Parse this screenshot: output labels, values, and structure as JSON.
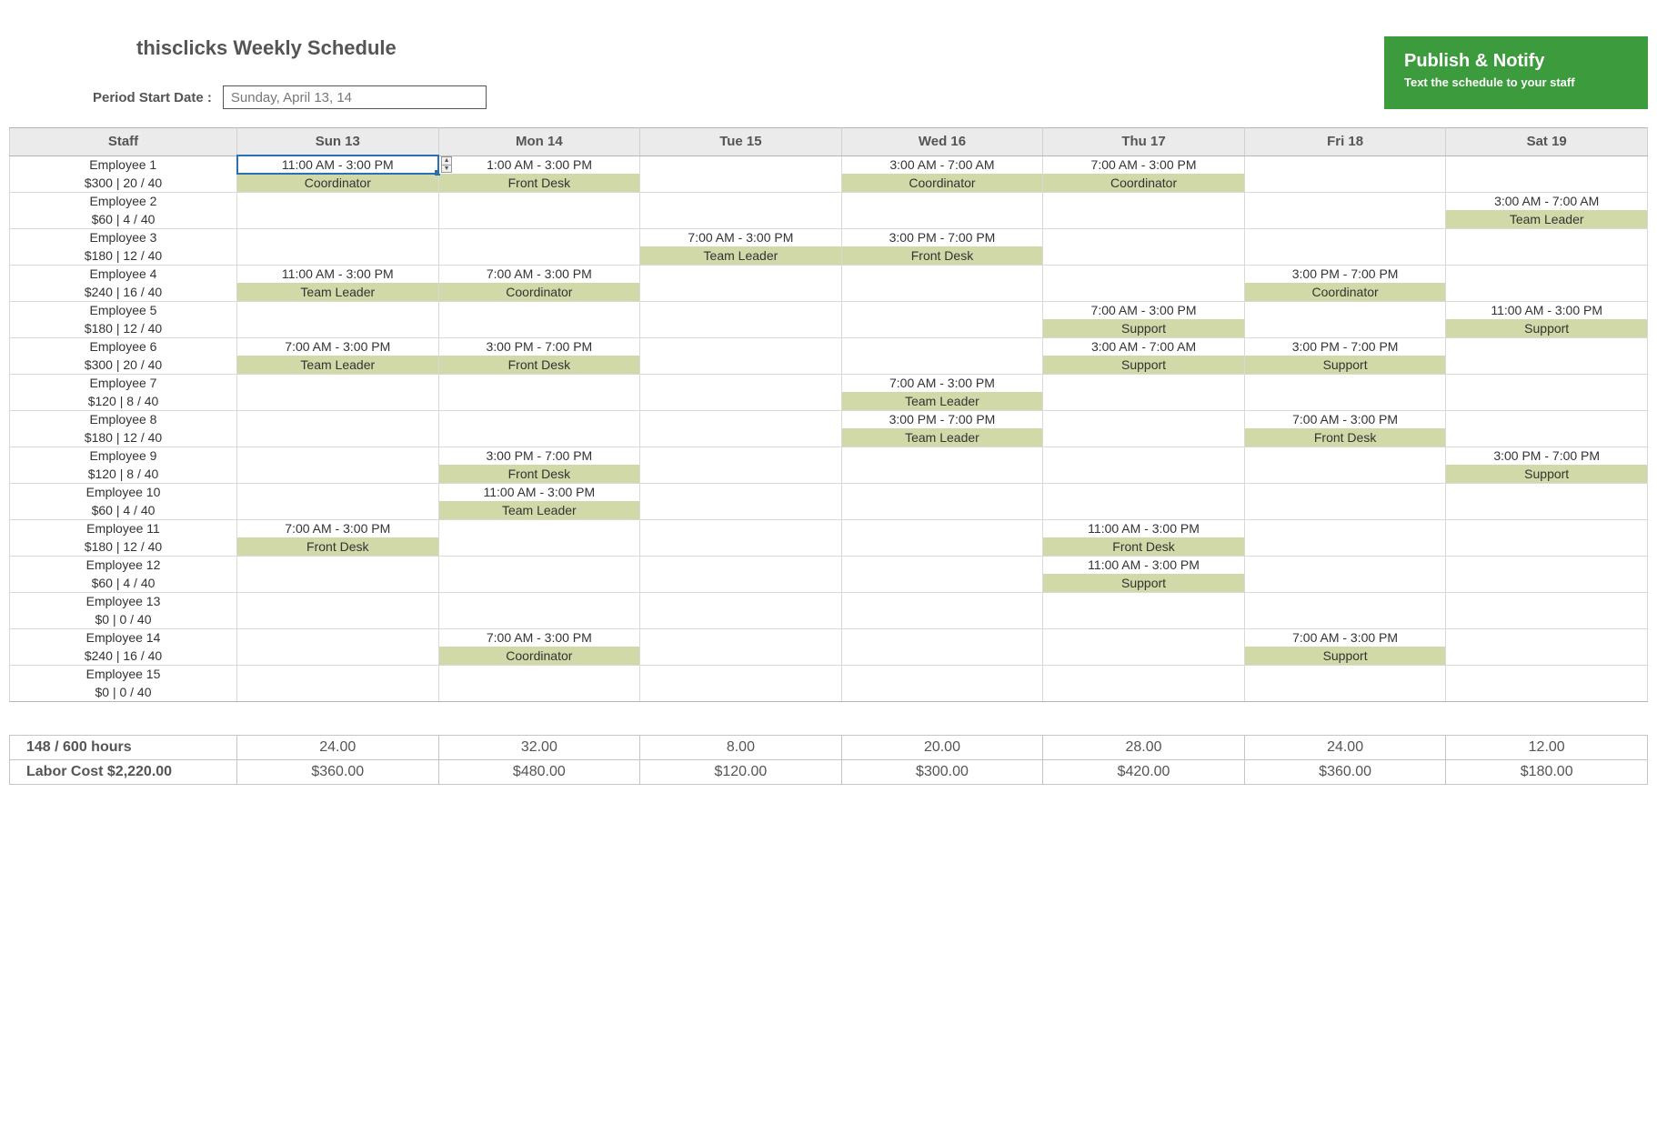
{
  "title": "thisclicks Weekly Schedule",
  "period_label": "Period Start Date :",
  "period_value": "Sunday, April 13, 14",
  "publish": {
    "title": "Publish & Notify",
    "subtitle": "Text the schedule to your staff"
  },
  "columns": [
    "Staff",
    "Sun 13",
    "Mon 14",
    "Tue 15",
    "Wed 16",
    "Thu 17",
    "Fri 18",
    "Sat 19"
  ],
  "selected_cell": {
    "row": 0,
    "day": 0
  },
  "employees": [
    {
      "name": "Employee 1",
      "info": "$300 | 20 / 40",
      "shifts": [
        {
          "time": "11:00 AM - 3:00 PM",
          "role": "Coordinator"
        },
        {
          "time": "1:00 AM - 3:00 PM",
          "role": "Front Desk",
          "stepper": true
        },
        null,
        {
          "time": "3:00 AM - 7:00 AM",
          "role": "Coordinator"
        },
        {
          "time": "7:00 AM - 3:00 PM",
          "role": "Coordinator"
        },
        null,
        null
      ]
    },
    {
      "name": "Employee 2",
      "info": "$60 | 4 / 40",
      "shifts": [
        null,
        null,
        null,
        null,
        null,
        null,
        {
          "time": "3:00 AM - 7:00 AM",
          "role": "Team Leader"
        }
      ]
    },
    {
      "name": "Employee 3",
      "info": "$180 | 12 / 40",
      "shifts": [
        null,
        null,
        {
          "time": "7:00 AM - 3:00 PM",
          "role": "Team Leader"
        },
        {
          "time": "3:00 PM - 7:00 PM",
          "role": "Front Desk"
        },
        null,
        null,
        null
      ]
    },
    {
      "name": "Employee 4",
      "info": "$240 | 16 / 40",
      "shifts": [
        {
          "time": "11:00 AM - 3:00 PM",
          "role": "Team Leader"
        },
        {
          "time": "7:00 AM - 3:00 PM",
          "role": "Coordinator"
        },
        null,
        null,
        null,
        {
          "time": "3:00 PM - 7:00 PM",
          "role": "Coordinator"
        },
        null
      ]
    },
    {
      "name": "Employee 5",
      "info": "$180 | 12 / 40",
      "shifts": [
        null,
        null,
        null,
        null,
        {
          "time": "7:00 AM - 3:00 PM",
          "role": "Support"
        },
        null,
        {
          "time": "11:00 AM - 3:00 PM",
          "role": "Support"
        }
      ]
    },
    {
      "name": "Employee 6",
      "info": "$300 | 20 / 40",
      "shifts": [
        {
          "time": "7:00 AM - 3:00 PM",
          "role": "Team Leader"
        },
        {
          "time": "3:00 PM - 7:00 PM",
          "role": "Front Desk"
        },
        null,
        null,
        {
          "time": "3:00 AM - 7:00 AM",
          "role": "Support"
        },
        {
          "time": "3:00 PM - 7:00 PM",
          "role": "Support"
        },
        null
      ]
    },
    {
      "name": "Employee 7",
      "info": "$120 | 8 / 40",
      "shifts": [
        null,
        null,
        null,
        {
          "time": "7:00 AM - 3:00 PM",
          "role": "Team Leader"
        },
        null,
        null,
        null
      ]
    },
    {
      "name": "Employee 8",
      "info": "$180 | 12 / 40",
      "shifts": [
        null,
        null,
        null,
        {
          "time": "3:00 PM - 7:00 PM",
          "role": "Team Leader"
        },
        null,
        {
          "time": "7:00 AM - 3:00 PM",
          "role": "Front Desk"
        },
        null
      ]
    },
    {
      "name": "Employee 9",
      "info": "$120 | 8 / 40",
      "shifts": [
        null,
        {
          "time": "3:00 PM - 7:00 PM",
          "role": "Front Desk"
        },
        null,
        null,
        null,
        null,
        {
          "time": "3:00 PM - 7:00 PM",
          "role": "Support"
        }
      ]
    },
    {
      "name": "Employee 10",
      "info": "$60 | 4 / 40",
      "shifts": [
        null,
        {
          "time": "11:00 AM - 3:00 PM",
          "role": "Team Leader"
        },
        null,
        null,
        null,
        null,
        null
      ]
    },
    {
      "name": "Employee 11",
      "info": "$180 | 12 / 40",
      "shifts": [
        {
          "time": "7:00 AM - 3:00 PM",
          "role": "Front Desk"
        },
        null,
        null,
        null,
        {
          "time": "11:00 AM - 3:00 PM",
          "role": "Front Desk"
        },
        null,
        null
      ]
    },
    {
      "name": "Employee 12",
      "info": "$60 | 4 / 40",
      "shifts": [
        null,
        null,
        null,
        null,
        {
          "time": "11:00 AM - 3:00 PM",
          "role": "Support"
        },
        null,
        null
      ]
    },
    {
      "name": "Employee 13",
      "info": "$0 | 0 / 40",
      "shifts": [
        null,
        null,
        null,
        null,
        null,
        null,
        null
      ]
    },
    {
      "name": "Employee 14",
      "info": "$240 | 16 / 40",
      "shifts": [
        null,
        {
          "time": "7:00 AM - 3:00 PM",
          "role": "Coordinator"
        },
        null,
        null,
        null,
        {
          "time": "7:00 AM - 3:00 PM",
          "role": "Support"
        },
        null
      ]
    },
    {
      "name": "Employee 15",
      "info": "$0 | 0 / 40",
      "shifts": [
        null,
        null,
        null,
        null,
        null,
        null,
        null
      ]
    }
  ],
  "summary": {
    "hours_label": "148 / 600 hours",
    "hours": [
      "24.00",
      "32.00",
      "8.00",
      "20.00",
      "28.00",
      "24.00",
      "12.00"
    ],
    "cost_label": "Labor Cost $2,220.00",
    "costs": [
      "$360.00",
      "$480.00",
      "$120.00",
      "$300.00",
      "$420.00",
      "$360.00",
      "$180.00"
    ]
  }
}
